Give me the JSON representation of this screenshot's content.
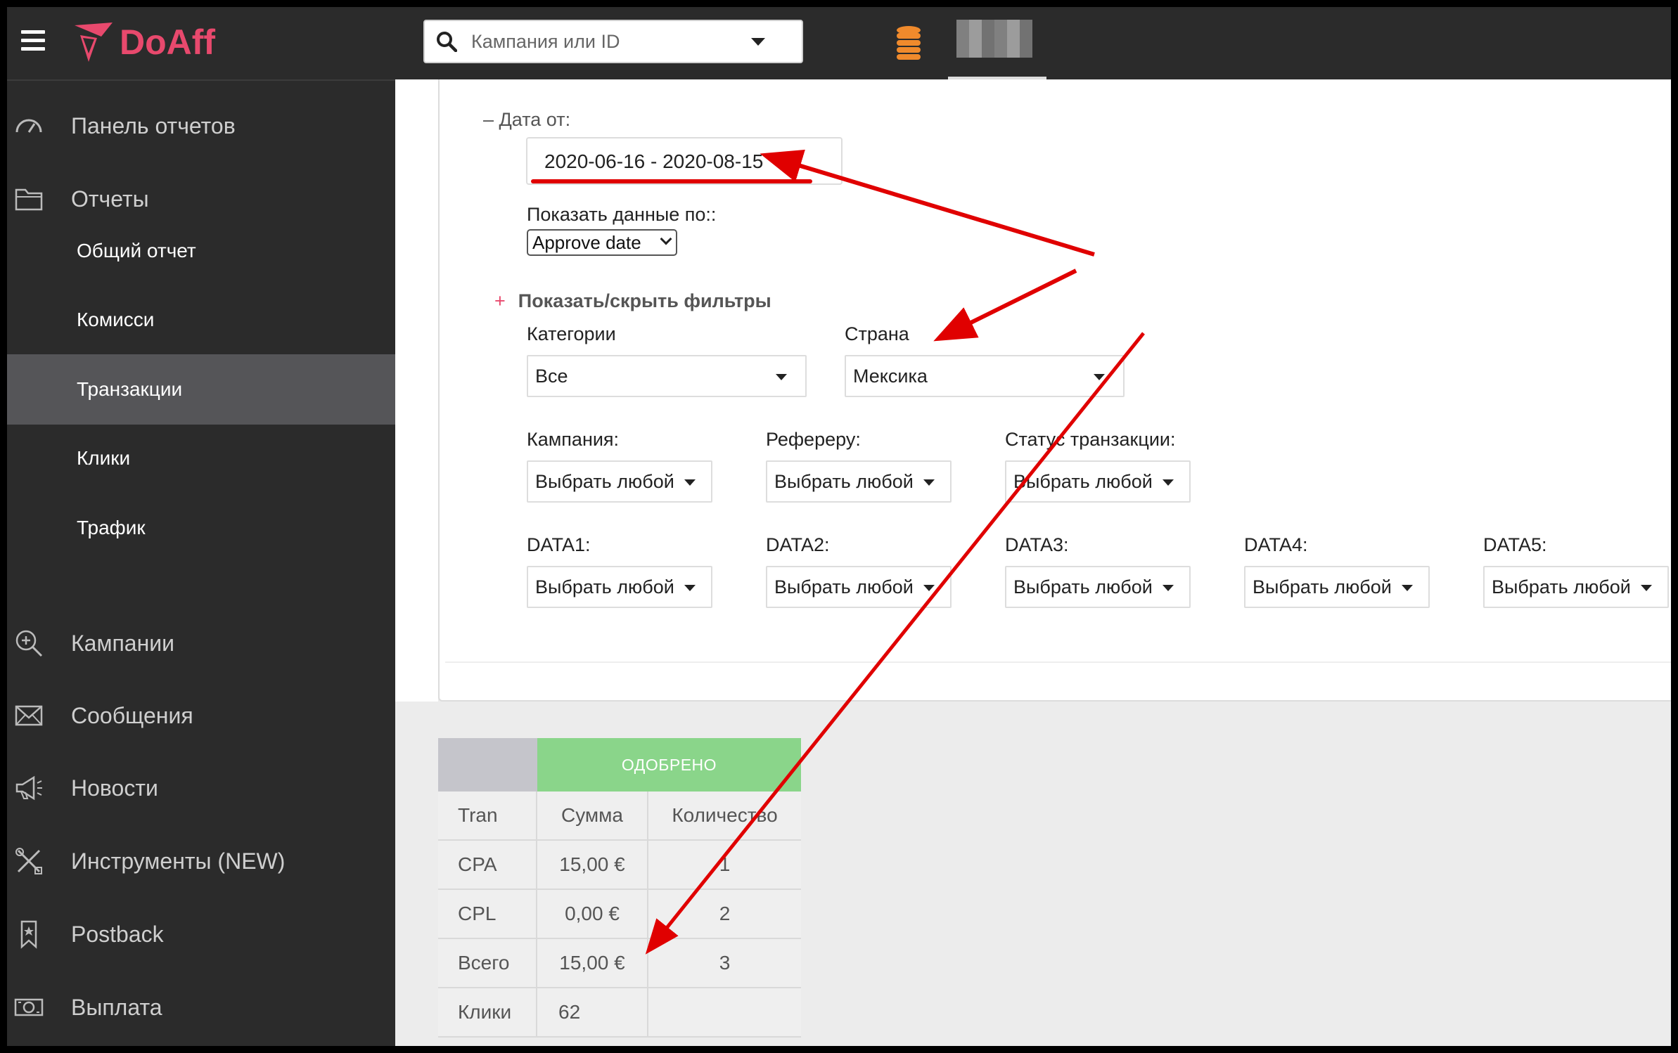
{
  "app": {
    "logo_text": "DoAff",
    "brand_color": "#e8496d"
  },
  "search": {
    "placeholder": "Кампания или ID",
    "value": ""
  },
  "sidebar": {
    "items": [
      {
        "label": "Панель отчетов",
        "icon": "gauge-icon"
      },
      {
        "label": "Отчеты",
        "icon": "folder-icon"
      },
      {
        "label": "Кампании",
        "icon": "zoom-in-icon"
      },
      {
        "label": "Сообщения",
        "icon": "envelope-icon"
      },
      {
        "label": "Новости",
        "icon": "megaphone-icon"
      },
      {
        "label": "Инструменты (NEW)",
        "icon": "tools-icon"
      },
      {
        "label": "Postback",
        "icon": "bookmark-icon"
      },
      {
        "label": "Выплата",
        "icon": "cash-icon"
      }
    ],
    "sub_items": [
      {
        "label": "Общий отчет"
      },
      {
        "label": "Комисси"
      },
      {
        "label": "Транзакции",
        "active": true
      },
      {
        "label": "Клики"
      },
      {
        "label": "Трафик"
      }
    ]
  },
  "filters": {
    "date_label": "– Дата от:",
    "date_value": "2020-06-16 - 2020-08-15",
    "show_by_label": "Показать данные по::",
    "show_by_value": "Approve date",
    "toggle_label": "Показать/скрыть фильтры",
    "toggle_plus": "+",
    "categories_label": "Категории",
    "categories_value": "Все",
    "country_label": "Страна",
    "country_value": "Мексика",
    "campaign_label": "Кампания:",
    "referer_label": "Рефереру:",
    "status_label": "Статус транзакции:",
    "data1_label": "DATA1:",
    "data2_label": "DATA2:",
    "data3_label": "DATA3:",
    "data4_label": "DATA4:",
    "data5_label": "DATA5:",
    "any_value": "Выбрать любой"
  },
  "stats": {
    "group_header": "ОДОБРЕНО",
    "columns": [
      "Tran",
      "Сумма",
      "Количество"
    ],
    "rows": [
      [
        "CPA",
        "15,00 €",
        "1"
      ],
      [
        "CPL",
        "0,00 €",
        "2"
      ],
      [
        "Всего",
        "15,00 €",
        "3"
      ],
      [
        "Клики",
        "62",
        ""
      ]
    ],
    "header_color": "#8ad58a"
  },
  "annotation_color": "#e00000"
}
